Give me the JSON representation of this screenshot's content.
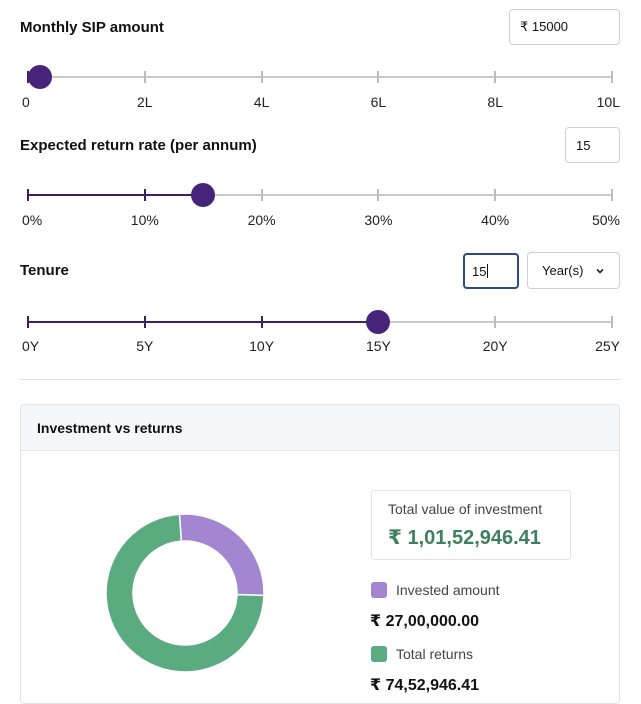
{
  "sip": {
    "label": "Monthly SIP amount",
    "value": "₹ 15000",
    "slider_fraction": 0.0214,
    "ticks": [
      "0",
      "2L",
      "4L",
      "6L",
      "8L",
      "10L"
    ]
  },
  "rate": {
    "label": "Expected return rate (per annum)",
    "value": "15",
    "slider_fraction": 0.3,
    "ticks": [
      "0%",
      "10%",
      "20%",
      "30%",
      "40%",
      "50%"
    ]
  },
  "tenure": {
    "label": "Tenure",
    "value": "15",
    "unit": "Year(s)",
    "slider_fraction": 0.6,
    "ticks": [
      "0Y",
      "5Y",
      "10Y",
      "15Y",
      "20Y",
      "25Y"
    ]
  },
  "card": {
    "title": "Investment vs returns",
    "total_label": "Total value of investment",
    "total_value": "₹ 1,01,52,946.41",
    "invested_label": "Invested amount",
    "invested_value": "₹ 27,00,000.00",
    "returns_label": "Total returns",
    "returns_value": "₹ 74,52,946.41",
    "invested_amount": 2700000,
    "returns_amount": 7452946.41
  },
  "colors": {
    "accent": "#45247a",
    "invested": "#a386d2",
    "returns": "#5bab81",
    "total_text": "#3e8060"
  }
}
